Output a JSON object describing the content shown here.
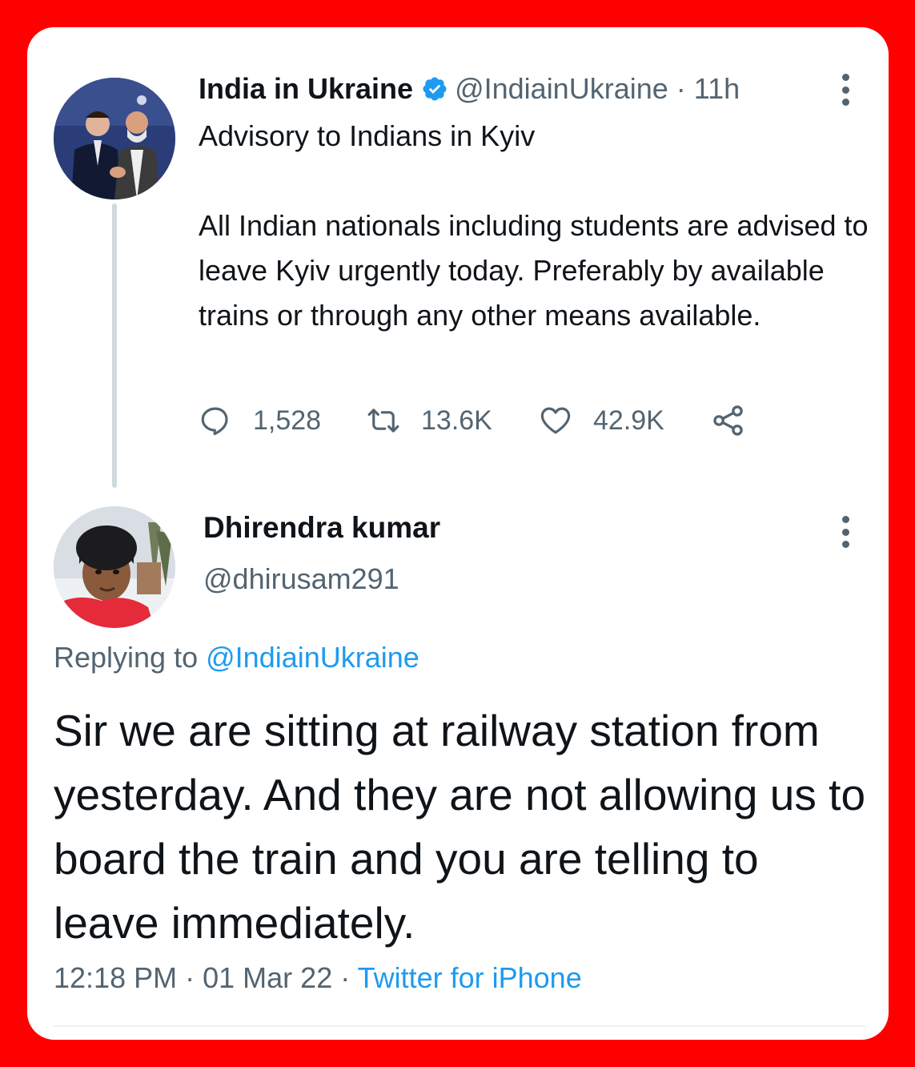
{
  "tweet": {
    "author_name": "India in Ukraine",
    "author_handle": "@IndiainUkraine",
    "separator": "·",
    "time_ago": "11h",
    "text_line1": "Advisory to Indians in Kyiv",
    "text_para": "All Indian nationals including students are advised to leave Kyiv urgently today. Preferably by available trains or through any other means available.",
    "replies": "1,528",
    "retweets": "13.6K",
    "likes": "42.9K"
  },
  "reply": {
    "author_name": "Dhirendra kumar",
    "author_handle": "@dhirusam291",
    "replying_prefix": "Replying to",
    "replying_to": "@IndiainUkraine",
    "text": "Sir we are sitting at railway station from yesterday. And they are not allowing us to board the train and you are telling to leave immediately.",
    "time": "12:18 PM",
    "date": "01 Mar 22",
    "separator": "·",
    "source": "Twitter for iPhone"
  },
  "colors": {
    "frame": "#ff0000",
    "accent": "#1d9bf0",
    "muted": "#536471",
    "text": "#0f1419"
  },
  "icons": [
    "verified-badge-icon",
    "more-icon",
    "reply-icon",
    "retweet-icon",
    "like-icon",
    "share-icon"
  ]
}
